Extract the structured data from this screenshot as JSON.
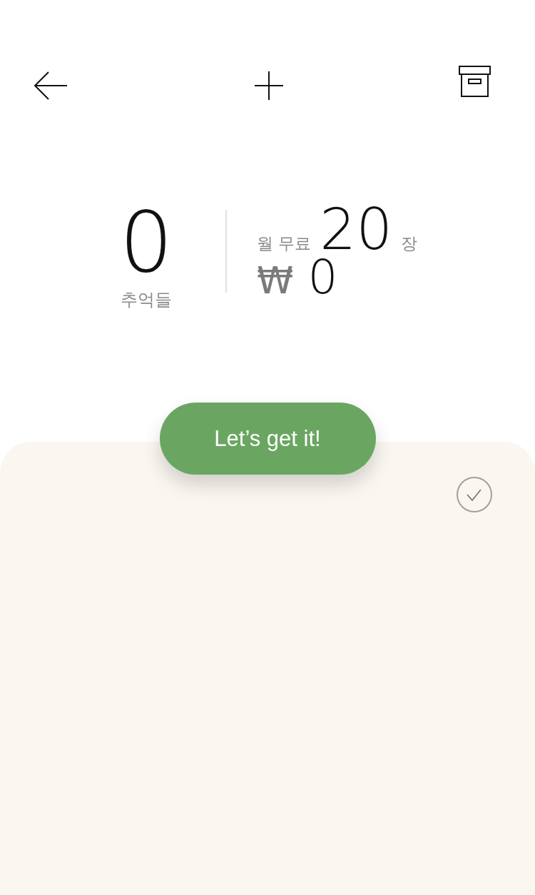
{
  "stats": {
    "count": "0",
    "count_label": "추억들",
    "free_prefix": "월 무료",
    "free_count": "20",
    "free_unit": "장",
    "currency": "₩",
    "price": "0"
  },
  "action_button": {
    "label": "Let’s get it!"
  }
}
